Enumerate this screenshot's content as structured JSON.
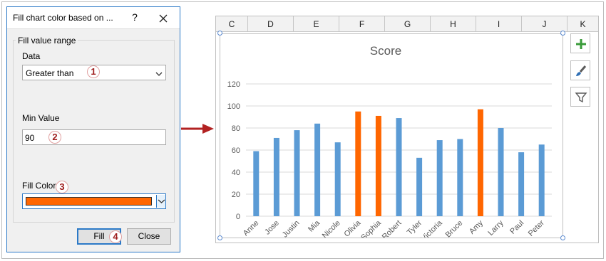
{
  "dialog": {
    "title": "Fill chart color based on ...",
    "help_label": "?",
    "group_label": "Fill value range",
    "data_label": "Data",
    "data_value": "Greater than",
    "min_value_label": "Min Value",
    "min_value": "90",
    "fill_color_label": "Fill Color",
    "fill_color": "#ff6600",
    "fill_button": "Fill",
    "close_button": "Close"
  },
  "steps": [
    "1",
    "2",
    "3",
    "4"
  ],
  "sheet": {
    "columns": [
      "C",
      "D",
      "E",
      "F",
      "G",
      "H",
      "I",
      "J",
      "K"
    ]
  },
  "chart_data": {
    "type": "bar",
    "title": "Score",
    "categories": [
      "Anne",
      "Jose",
      "Justin",
      "Mia",
      "Nicole",
      "Olivia",
      "Sophia",
      "Robert",
      "Tyler",
      "Victoria",
      "Bruce",
      "Amy",
      "Larry",
      "Paul",
      "Peter"
    ],
    "values": [
      59,
      71,
      78,
      84,
      67,
      95,
      91,
      89,
      53,
      69,
      70,
      97,
      80,
      58,
      65
    ],
    "ylim": [
      0,
      120
    ],
    "yticks": [
      "0",
      "20",
      "40",
      "60",
      "80",
      "100",
      "120"
    ],
    "grid": true,
    "base_color": "#5b9bd5",
    "highlight_color": "#ff6600",
    "highlight_threshold": 90
  }
}
